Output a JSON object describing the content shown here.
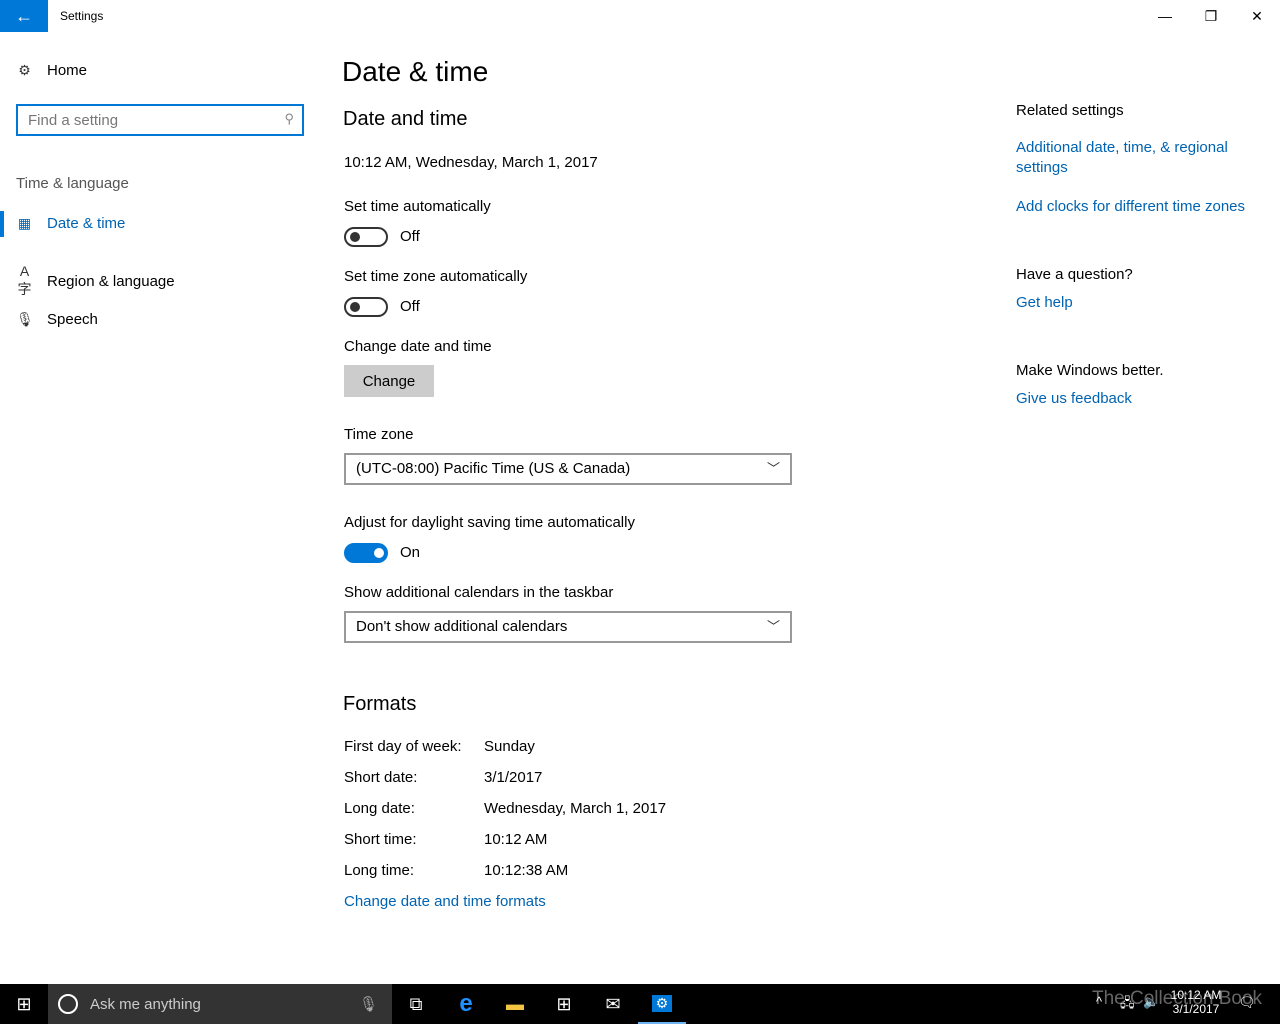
{
  "window": {
    "title": "Settings",
    "back": "←",
    "minimize": "—",
    "restore": "❐",
    "close": "✕"
  },
  "sidebar": {
    "home": "Home",
    "search_placeholder": "Find a setting",
    "section": "Time & language",
    "items": [
      {
        "label": "Date & time",
        "icon": "calendar-clock-icon"
      },
      {
        "label": "Region & language",
        "icon": "region-language-icon"
      },
      {
        "label": "Speech",
        "icon": "microphone-icon"
      }
    ]
  },
  "main": {
    "page_title": "Date & time",
    "section_title": "Date and time",
    "current": "10:12 AM, Wednesday, March 1, 2017",
    "set_time_auto": {
      "label": "Set time automatically",
      "state": "Off"
    },
    "set_tz_auto": {
      "label": "Set time zone automatically",
      "state": "Off"
    },
    "change": {
      "label": "Change date and time",
      "button": "Change"
    },
    "time_zone": {
      "label": "Time zone",
      "value": "(UTC-08:00) Pacific Time (US & Canada)"
    },
    "dst": {
      "label": "Adjust for daylight saving time automatically",
      "state": "On"
    },
    "calendars": {
      "label": "Show additional calendars in the taskbar",
      "value": "Don't show additional calendars"
    },
    "formats": {
      "title": "Formats",
      "rows": [
        {
          "k": "First day of week:",
          "v": "Sunday"
        },
        {
          "k": "Short date:",
          "v": "3/1/2017"
        },
        {
          "k": "Long date:",
          "v": "Wednesday, March 1, 2017"
        },
        {
          "k": "Short time:",
          "v": "10:12 AM"
        },
        {
          "k": "Long time:",
          "v": "10:12:38 AM"
        }
      ],
      "link": "Change date and time formats"
    }
  },
  "related": {
    "title": "Related settings",
    "link1": "Additional date, time, & regional settings",
    "link2": "Add clocks for different time zones",
    "question": "Have a question?",
    "help": "Get help",
    "better": "Make Windows better.",
    "feedback": "Give us feedback"
  },
  "taskbar": {
    "search": "Ask me anything",
    "time": "10:12 AM",
    "date": "3/1/2017",
    "watermark": "The Collection Book"
  },
  "colors": {
    "accent": "#0078d7",
    "link": "#0063b1"
  }
}
